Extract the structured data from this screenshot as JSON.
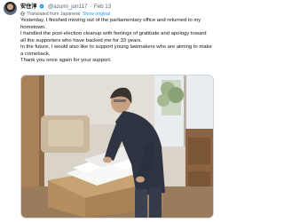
{
  "author": {
    "display_name": "安住淳",
    "handle": "@azumi_jun117",
    "separator": "·",
    "date": "Feb 13",
    "verified": true,
    "verified_color": "#1d9bf0"
  },
  "translation_bar": {
    "label": "Translated from Japanese",
    "show_original": "Show original",
    "link_color": "#1d9bf0"
  },
  "tweet": {
    "text": "Yesterday, I finished moving out of the parliamentary office and returned to my hometown.\nI handled the post-election cleanup with feelings of gratitude and apology toward all the supporters who have backed me for 33 years.\nIn the future, I would also like to support young lawmakers who are aiming to make a comeback.\nThank you once again for your support."
  },
  "media": {
    "icon": "photo-icon"
  }
}
